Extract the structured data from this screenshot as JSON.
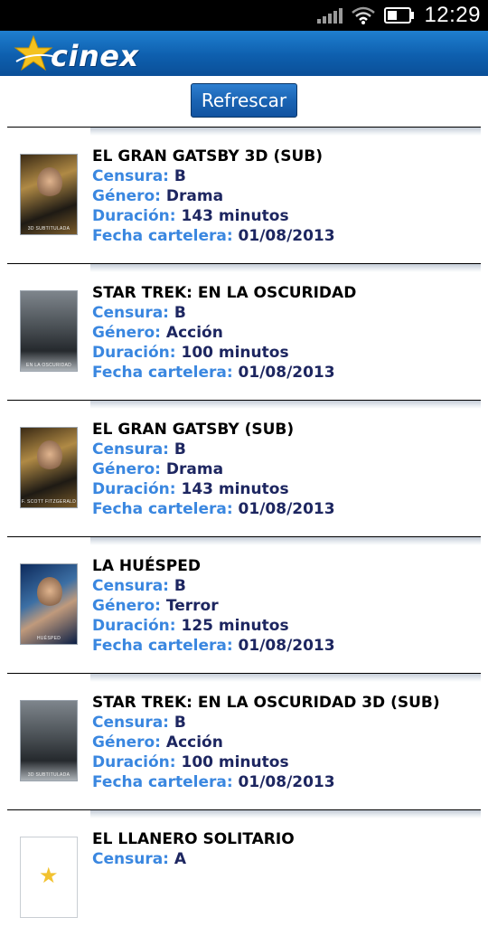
{
  "status_bar": {
    "time": "12:29",
    "icons": [
      "signal-icon",
      "wifi-icon",
      "battery-icon"
    ]
  },
  "header": {
    "logo_text": "cinex"
  },
  "refresh_label": "Refrescar",
  "labels": {
    "censura": "Censura:",
    "genero": "Género:",
    "duracion": "Duración:",
    "fecha": "Fecha cartelera:"
  },
  "movies": [
    {
      "title": "EL GRAN GATSBY 3D (SUB)",
      "censura": "B",
      "genero": "Drama",
      "duracion": "143 minutos",
      "fecha": "01/08/2013",
      "poster_caption": "3D SUBTITULADA"
    },
    {
      "title": "STAR TREK: EN LA OSCURIDAD",
      "censura": "B",
      "genero": "Acción",
      "duracion": "100 minutos",
      "fecha": "01/08/2013",
      "poster_caption": "EN LA OSCURIDAD"
    },
    {
      "title": "EL GRAN GATSBY (SUB)",
      "censura": "B",
      "genero": "Drama",
      "duracion": "143 minutos",
      "fecha": "01/08/2013",
      "poster_caption": "F. SCOTT FITZGERALD"
    },
    {
      "title": "LA HUÉSPED",
      "censura": "B",
      "genero": "Terror",
      "duracion": "125 minutos",
      "fecha": "01/08/2013",
      "poster_caption": "HUÉSPED"
    },
    {
      "title": "STAR TREK: EN LA OSCURIDAD 3D (SUB)",
      "censura": "B",
      "genero": "Acción",
      "duracion": "100 minutos",
      "fecha": "01/08/2013",
      "poster_caption": "3D SUBTITULADA"
    },
    {
      "title": "EL LLANERO SOLITARIO",
      "censura": "A",
      "genero": "",
      "duracion": "",
      "fecha": "",
      "poster_caption": ""
    }
  ],
  "colors": {
    "label_blue": "#3a87e0",
    "value_navy": "#1d2660",
    "header_blue": "#0e5fae"
  }
}
